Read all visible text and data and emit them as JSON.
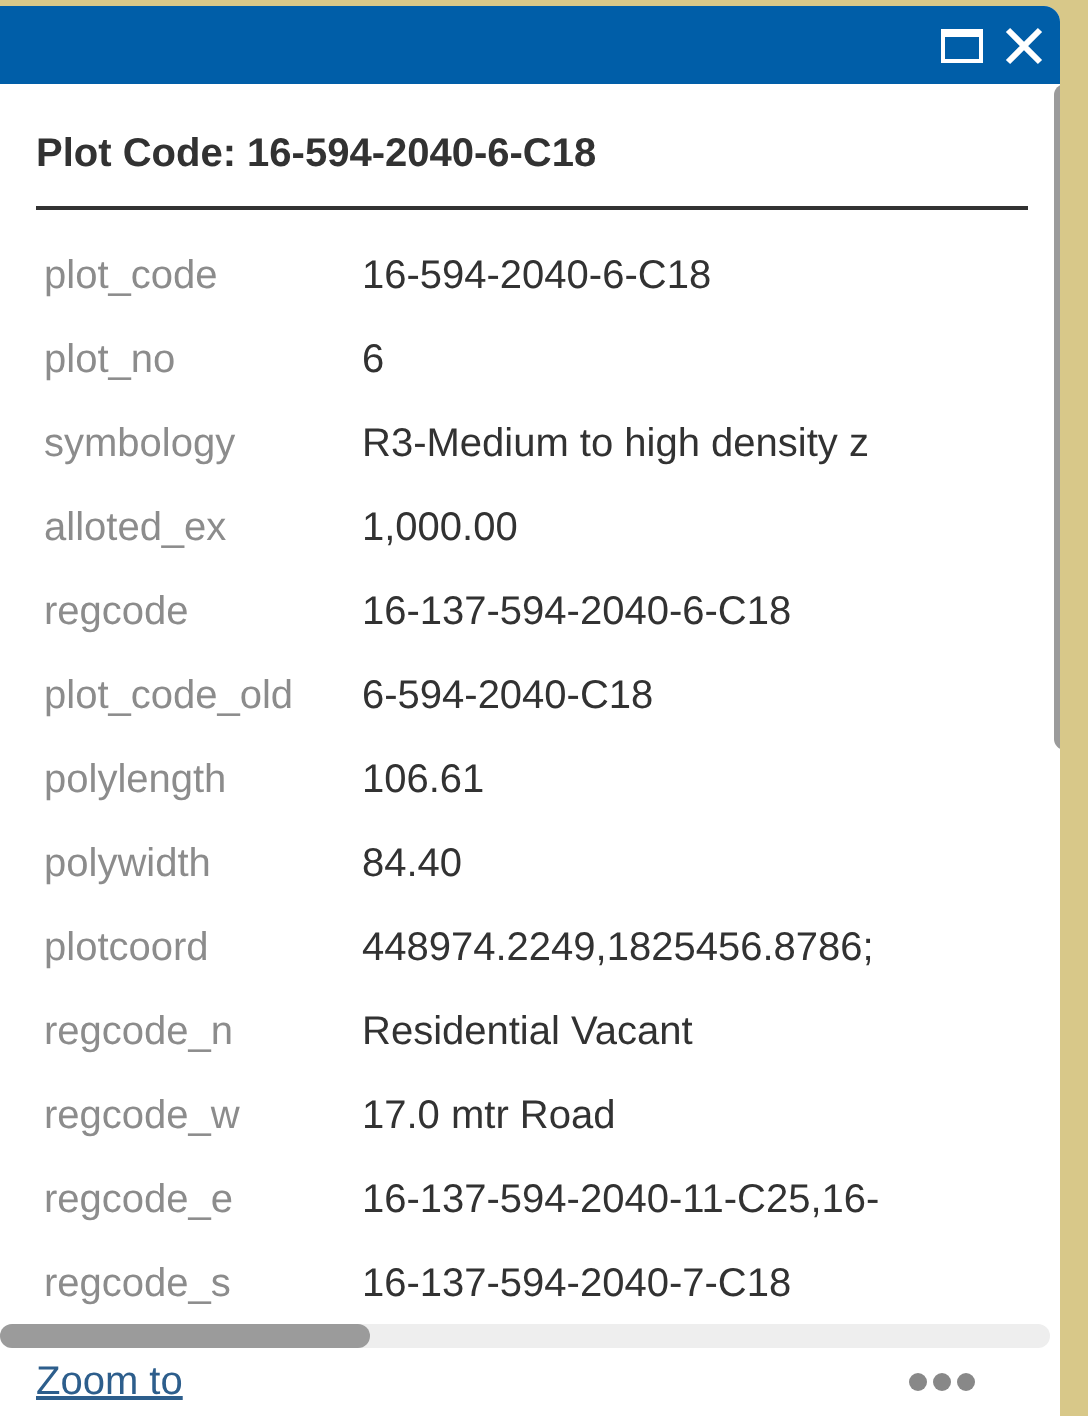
{
  "popup": {
    "title": "Plot Code: 16-594-2040-6-C18"
  },
  "fields": [
    {
      "label": "plot_code",
      "value": "16-594-2040-6-C18"
    },
    {
      "label": "plot_no",
      "value": "6"
    },
    {
      "label": "symbology",
      "value": "R3-Medium to high density z"
    },
    {
      "label": "alloted_ex",
      "value": "1,000.00"
    },
    {
      "label": "regcode",
      "value": "16-137-594-2040-6-C18"
    },
    {
      "label": "plot_code_old",
      "value": "6-594-2040-C18"
    },
    {
      "label": "polylength",
      "value": "106.61"
    },
    {
      "label": "polywidth",
      "value": "84.40"
    },
    {
      "label": "plotcoord",
      "value": "448974.2249,1825456.8786;"
    },
    {
      "label": "regcode_n",
      "value": "Residential Vacant"
    },
    {
      "label": "regcode_w",
      "value": "17.0 mtr Road"
    },
    {
      "label": "regcode_e",
      "value": "16-137-594-2040-11-C25,16-"
    },
    {
      "label": "regcode_s",
      "value": "16-137-594-2040-7-C18"
    }
  ],
  "footer": {
    "link": "Zoom to"
  }
}
